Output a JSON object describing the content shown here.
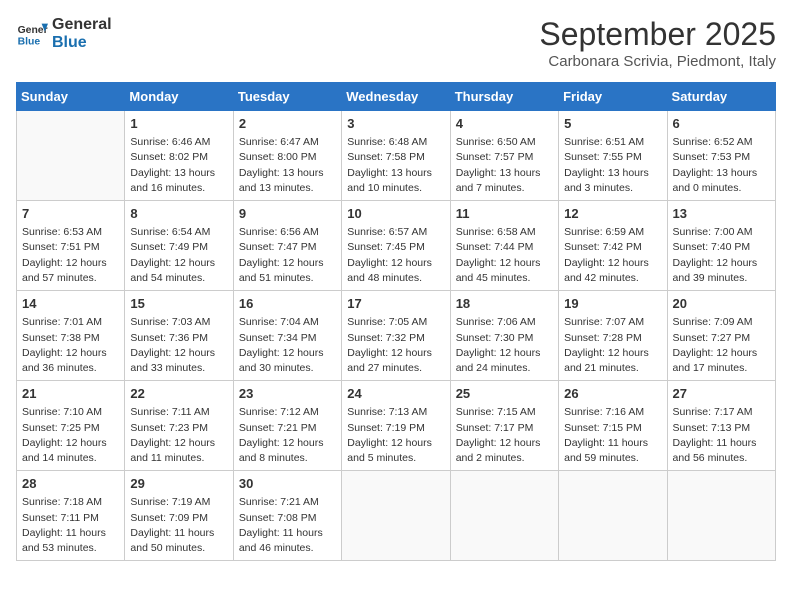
{
  "header": {
    "logo_line1": "General",
    "logo_line2": "Blue",
    "title": "September 2025",
    "subtitle": "Carbonara Scrivia, Piedmont, Italy"
  },
  "days_of_week": [
    "Sunday",
    "Monday",
    "Tuesday",
    "Wednesday",
    "Thursday",
    "Friday",
    "Saturday"
  ],
  "weeks": [
    [
      {
        "day": "",
        "info": ""
      },
      {
        "day": "1",
        "info": "Sunrise: 6:46 AM\nSunset: 8:02 PM\nDaylight: 13 hours\nand 16 minutes."
      },
      {
        "day": "2",
        "info": "Sunrise: 6:47 AM\nSunset: 8:00 PM\nDaylight: 13 hours\nand 13 minutes."
      },
      {
        "day": "3",
        "info": "Sunrise: 6:48 AM\nSunset: 7:58 PM\nDaylight: 13 hours\nand 10 minutes."
      },
      {
        "day": "4",
        "info": "Sunrise: 6:50 AM\nSunset: 7:57 PM\nDaylight: 13 hours\nand 7 minutes."
      },
      {
        "day": "5",
        "info": "Sunrise: 6:51 AM\nSunset: 7:55 PM\nDaylight: 13 hours\nand 3 minutes."
      },
      {
        "day": "6",
        "info": "Sunrise: 6:52 AM\nSunset: 7:53 PM\nDaylight: 13 hours\nand 0 minutes."
      }
    ],
    [
      {
        "day": "7",
        "info": "Sunrise: 6:53 AM\nSunset: 7:51 PM\nDaylight: 12 hours\nand 57 minutes."
      },
      {
        "day": "8",
        "info": "Sunrise: 6:54 AM\nSunset: 7:49 PM\nDaylight: 12 hours\nand 54 minutes."
      },
      {
        "day": "9",
        "info": "Sunrise: 6:56 AM\nSunset: 7:47 PM\nDaylight: 12 hours\nand 51 minutes."
      },
      {
        "day": "10",
        "info": "Sunrise: 6:57 AM\nSunset: 7:45 PM\nDaylight: 12 hours\nand 48 minutes."
      },
      {
        "day": "11",
        "info": "Sunrise: 6:58 AM\nSunset: 7:44 PM\nDaylight: 12 hours\nand 45 minutes."
      },
      {
        "day": "12",
        "info": "Sunrise: 6:59 AM\nSunset: 7:42 PM\nDaylight: 12 hours\nand 42 minutes."
      },
      {
        "day": "13",
        "info": "Sunrise: 7:00 AM\nSunset: 7:40 PM\nDaylight: 12 hours\nand 39 minutes."
      }
    ],
    [
      {
        "day": "14",
        "info": "Sunrise: 7:01 AM\nSunset: 7:38 PM\nDaylight: 12 hours\nand 36 minutes."
      },
      {
        "day": "15",
        "info": "Sunrise: 7:03 AM\nSunset: 7:36 PM\nDaylight: 12 hours\nand 33 minutes."
      },
      {
        "day": "16",
        "info": "Sunrise: 7:04 AM\nSunset: 7:34 PM\nDaylight: 12 hours\nand 30 minutes."
      },
      {
        "day": "17",
        "info": "Sunrise: 7:05 AM\nSunset: 7:32 PM\nDaylight: 12 hours\nand 27 minutes."
      },
      {
        "day": "18",
        "info": "Sunrise: 7:06 AM\nSunset: 7:30 PM\nDaylight: 12 hours\nand 24 minutes."
      },
      {
        "day": "19",
        "info": "Sunrise: 7:07 AM\nSunset: 7:28 PM\nDaylight: 12 hours\nand 21 minutes."
      },
      {
        "day": "20",
        "info": "Sunrise: 7:09 AM\nSunset: 7:27 PM\nDaylight: 12 hours\nand 17 minutes."
      }
    ],
    [
      {
        "day": "21",
        "info": "Sunrise: 7:10 AM\nSunset: 7:25 PM\nDaylight: 12 hours\nand 14 minutes."
      },
      {
        "day": "22",
        "info": "Sunrise: 7:11 AM\nSunset: 7:23 PM\nDaylight: 12 hours\nand 11 minutes."
      },
      {
        "day": "23",
        "info": "Sunrise: 7:12 AM\nSunset: 7:21 PM\nDaylight: 12 hours\nand 8 minutes."
      },
      {
        "day": "24",
        "info": "Sunrise: 7:13 AM\nSunset: 7:19 PM\nDaylight: 12 hours\nand 5 minutes."
      },
      {
        "day": "25",
        "info": "Sunrise: 7:15 AM\nSunset: 7:17 PM\nDaylight: 12 hours\nand 2 minutes."
      },
      {
        "day": "26",
        "info": "Sunrise: 7:16 AM\nSunset: 7:15 PM\nDaylight: 11 hours\nand 59 minutes."
      },
      {
        "day": "27",
        "info": "Sunrise: 7:17 AM\nSunset: 7:13 PM\nDaylight: 11 hours\nand 56 minutes."
      }
    ],
    [
      {
        "day": "28",
        "info": "Sunrise: 7:18 AM\nSunset: 7:11 PM\nDaylight: 11 hours\nand 53 minutes."
      },
      {
        "day": "29",
        "info": "Sunrise: 7:19 AM\nSunset: 7:09 PM\nDaylight: 11 hours\nand 50 minutes."
      },
      {
        "day": "30",
        "info": "Sunrise: 7:21 AM\nSunset: 7:08 PM\nDaylight: 11 hours\nand 46 minutes."
      },
      {
        "day": "",
        "info": ""
      },
      {
        "day": "",
        "info": ""
      },
      {
        "day": "",
        "info": ""
      },
      {
        "day": "",
        "info": ""
      }
    ]
  ]
}
